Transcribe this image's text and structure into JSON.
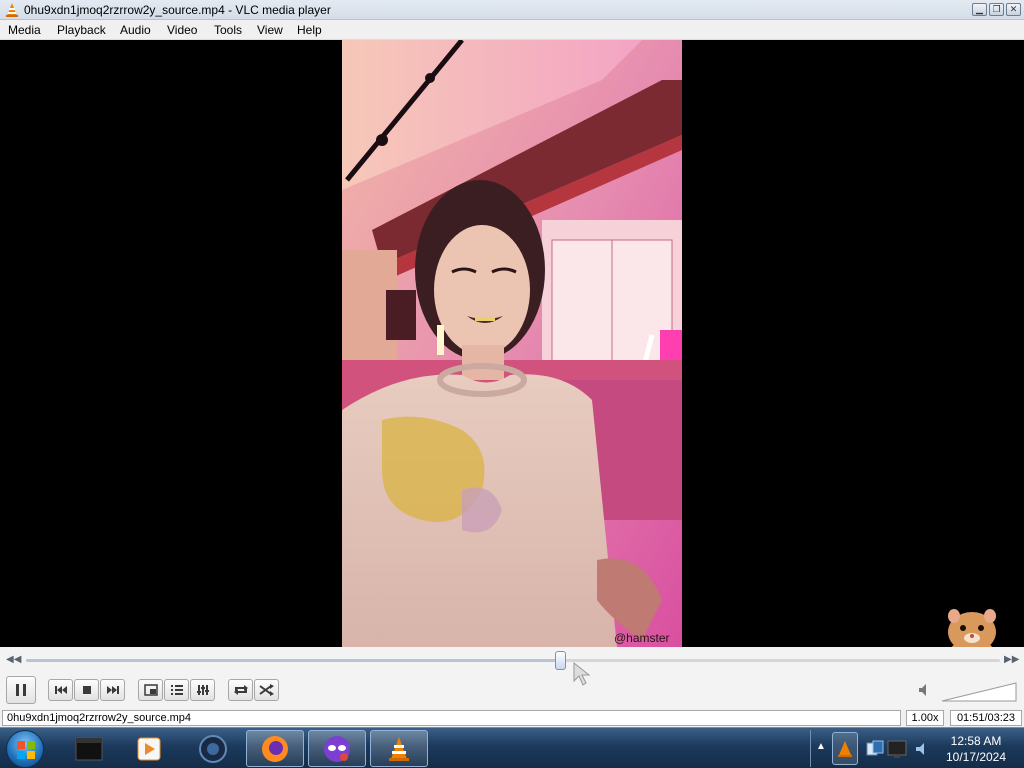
{
  "window": {
    "title": "0hu9xdn1jmoq2rzrrow2y_source.mp4 - VLC media player",
    "minimize_icon": "minimize-icon",
    "maximize_icon": "restore-icon",
    "close_icon": "close-icon"
  },
  "menu": [
    {
      "label": "Media"
    },
    {
      "label": "Playback"
    },
    {
      "label": "Audio"
    },
    {
      "label": "Video"
    },
    {
      "label": "Tools"
    },
    {
      "label": "View"
    },
    {
      "label": "Help"
    }
  ],
  "video": {
    "watermark": "@hamster"
  },
  "playback": {
    "progress_fraction": 0.5479,
    "elapsed": "01:51",
    "total": "03:23",
    "time_display": "01:51/03:23",
    "speed": "1.00x",
    "volume_percent": 0
  },
  "controls": {
    "icons": [
      "pause-icon",
      "previous-icon",
      "stop-icon",
      "next-icon",
      "fullscreen-icon",
      "playlist-icon",
      "extended-settings-icon",
      "loop-icon",
      "shuffle-icon"
    ]
  },
  "status": {
    "filename": "0hu9xdn1jmoq2rzrrow2y_source.mp4"
  },
  "taskbar": {
    "apps": [
      "start-orb",
      "terminal-icon",
      "media-player-icon",
      "globe-app-icon",
      "firefox-icon",
      "privacy-app-icon",
      "vlc-icon"
    ],
    "clock_time": "12:58 AM",
    "clock_date": "10/17/2024"
  },
  "colors": {
    "titlebar": "#dce3ec",
    "taskbar": "#1c3a5c",
    "vlc_orange": "#f08000"
  }
}
